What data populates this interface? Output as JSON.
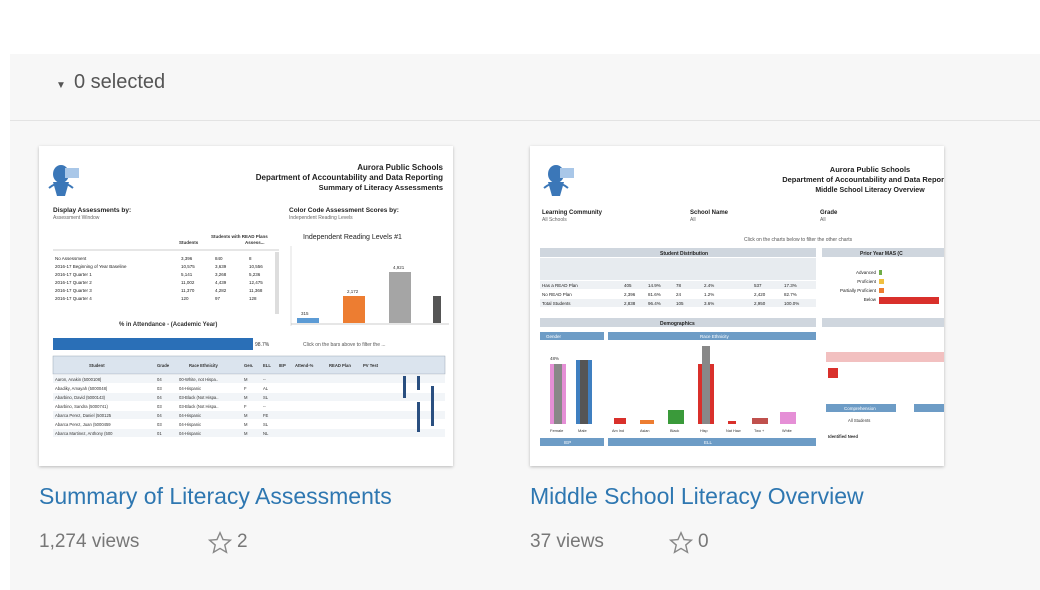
{
  "selection": {
    "label": "0 selected"
  },
  "cards": [
    {
      "title": "Summary of Literacy Assessments",
      "views": "1,274 views",
      "favorites": "2",
      "thumb": {
        "org": "Aurora Public Schools",
        "dept": "Department of Accountability and Data Reporting",
        "subtitle": "Summary of Literacy Assessments",
        "left_label": "Display Assessments by:",
        "left_sub": "Assessment Window",
        "right_label": "Color Code Assessment Scores by:",
        "right_sub": "Independent Reading Levels",
        "col_headers": [
          "Students",
          "Students with READ Plans",
          "Assess..."
        ],
        "rows": [
          [
            "No Assessment",
            "3,396",
            "840",
            "8"
          ],
          [
            "2016-17 Beginning of Year Baseline",
            "10,575",
            "3,639",
            "10,556"
          ],
          [
            "2016-17 Quarter 1",
            "5,141",
            "3,268",
            "5,236"
          ],
          [
            "2016-17 Quarter 2",
            "11,002",
            "4,439",
            "12,475"
          ],
          [
            "2016-17 Quarter 3",
            "11,370",
            "4,282",
            "11,368"
          ],
          [
            "2016-17 Quarter 4",
            "120",
            "97",
            "128"
          ]
        ],
        "chart_title": "Independent Reading Levels #1",
        "bar_values": [
          "315",
          "2,172",
          "4,921"
        ],
        "attendance_label": "% in Attendance - (Academic Year)",
        "attendance_value": "98.7%",
        "click_note": "Click on the bars above to filter the ...",
        "student_headers": [
          "Student",
          "Grade",
          "Race Ethnicity",
          "Gen.",
          "ELL",
          "IEP",
          "Attend-%",
          "READ Plan",
          "PV Test"
        ],
        "students": [
          [
            "Aaron, Anakin (5000108)",
            "04",
            "00-White, not Hispa..",
            "M",
            "--"
          ],
          [
            "Abadiky, Amayah (5000048)",
            "03",
            "04-Hispanic",
            "F",
            "AL"
          ],
          [
            "Abarbino, David (5000143)",
            "04",
            "03-Black (Not Hispa..",
            "M",
            "SL"
          ],
          [
            "Abarbino, Sandra (5000741)",
            "03",
            "03-Black (Not Hispa..",
            "F",
            "--"
          ],
          [
            "Abarca Perez, Daniel (500125",
            "04",
            "04-Hispanic",
            "M",
            "FE"
          ],
          [
            "Abarca Perez, Juan (5000459",
            "03",
            "04-Hispanic",
            "M",
            "SL"
          ],
          [
            "Abarca Martinez, Anthony (500",
            "01",
            "04-Hispanic",
            "M",
            "NL"
          ]
        ]
      }
    },
    {
      "title": "Middle School Literacy Overview",
      "views": "37 views",
      "favorites": "0",
      "thumb": {
        "org": "Aurora Public Schools",
        "dept": "Department of Accountability and Data Reporting",
        "subtitle": "Middle School Literacy Overview",
        "filter1_label": "Learning Community",
        "filter1_value": "All Schools",
        "filter2_label": "School Name",
        "filter2_value": "All",
        "filter3_label": "Grade",
        "filter3_value": "All",
        "click_note": "Click on the charts below to filter the other charts",
        "dist_header": "Student Distribution",
        "prior_header": "Prior Year MAS (C",
        "dist_rows": [
          [
            "Has a READ Plan",
            "405",
            "14.9%",
            "78",
            "2.4%",
            "537",
            "17.3%"
          ],
          [
            "No READ Plan",
            "2,396",
            "81.6%",
            "24",
            "1.2%",
            "2,420",
            "82.7%"
          ],
          [
            "Total Students",
            "2,838",
            "96.4%",
            "105",
            "3.6%",
            "2,950",
            "100.0%"
          ]
        ],
        "prior_rows": [
          "Advanced",
          "Proficient",
          "Partially Proficient",
          "Below"
        ],
        "demo_header": "Demographics",
        "gender_header": "Gender",
        "race_header": "Race Ethnicity",
        "gender_bars": [
          "Female",
          "Male"
        ],
        "gender_value": "48%",
        "race_bars": [
          "Am Ind",
          "Asian",
          "Black",
          "Hisp",
          "Nat Haw",
          "Two +",
          "White"
        ],
        "comprehension": "Comprehension",
        "all_students": "All Students",
        "identified": "Identified Need",
        "iep_header": "IEP",
        "ell_header": "ELL"
      }
    }
  ]
}
